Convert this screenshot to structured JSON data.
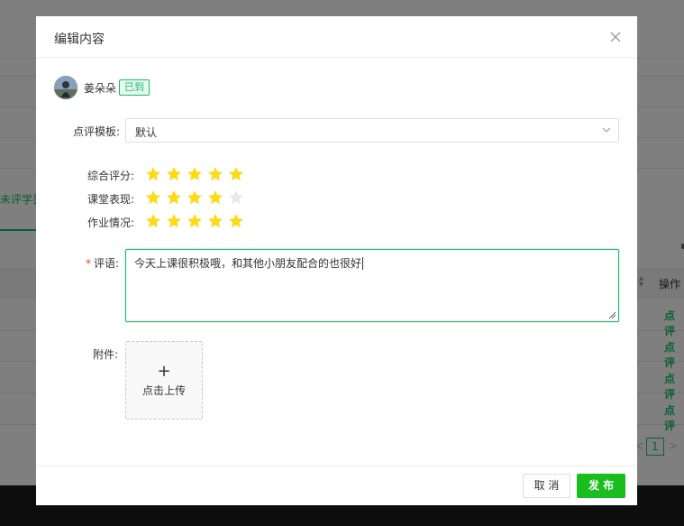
{
  "background": {
    "tab_label": "未评学员",
    "table_header_action": "操作",
    "row_links": [
      "点评",
      "点评",
      "点评",
      "点评"
    ],
    "pager_current": "1"
  },
  "modal": {
    "title": "编辑内容",
    "student": {
      "name": "姜朵朵",
      "status": "已到"
    },
    "template": {
      "label": "点评模板:",
      "value": "默认"
    },
    "ratings": [
      {
        "label": "综合评分:",
        "stars": 5,
        "max": 5
      },
      {
        "label": "课堂表现:",
        "stars": 4,
        "max": 5
      },
      {
        "label": "作业情况:",
        "stars": 5,
        "max": 5
      }
    ],
    "comment": {
      "required_mark": "*",
      "label": "评语:",
      "value": "今天上课很积极哦，和其他小朋友配合的也很好"
    },
    "attachment": {
      "label": "附件:",
      "upload_icon": "+",
      "upload_label": "点击上传"
    },
    "footer": {
      "cancel_label": "取 消",
      "publish_label": "发 布"
    }
  },
  "colors": {
    "accent": "#19be6b",
    "publish_button": "#19be1e",
    "star_filled": "#fadb14",
    "star_empty": "#e9e9e9",
    "required": "#ed4014"
  }
}
